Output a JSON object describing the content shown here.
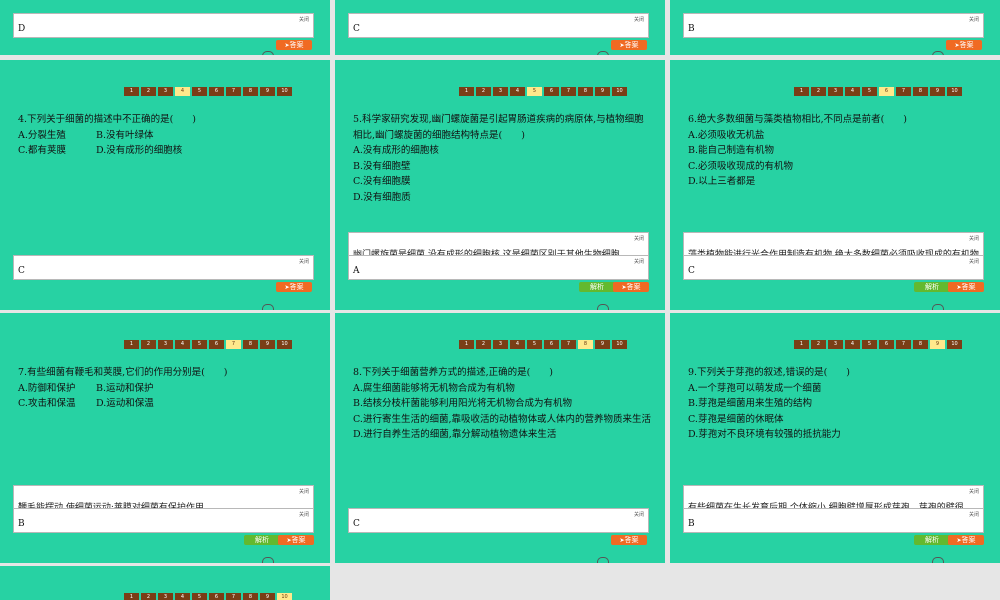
{
  "nav_numbers": [
    "1",
    "2",
    "3",
    "4",
    "5",
    "6",
    "7",
    "8",
    "9",
    "10"
  ],
  "close_label": "关闭",
  "answer_button_label": "答案",
  "analysis_button_label": "解析",
  "top_row": [
    {
      "answer": "D"
    },
    {
      "answer": "C"
    },
    {
      "answer": "B"
    }
  ],
  "questions": [
    {
      "stem": "4.下列关于细菌的描述中不正确的是(　　)",
      "options": [
        "A.分裂生殖",
        "B.没有叶绿体",
        "C.都有荚膜",
        "D.没有成形的细胞核"
      ],
      "answer": "C",
      "current": 4
    },
    {
      "stem": "5.科学家研究发现,幽门螺旋菌是引起胃肠道疾病的病原体,与植物细胞相比,幽门螺旋菌的细胞结构特点是(　　)",
      "options": [
        "A.没有成形的细胞核",
        "B.没有细胞壁",
        "C.没有细胞膜",
        "D.没有细胞质"
      ],
      "answer": "A",
      "current": 5,
      "explanation": "幽门螺旋菌是细菌,没有成形的细胞核,这是细菌区别于其他生物细胞"
    },
    {
      "stem": "6.绝大多数细菌与藻类植物相比,不同点是前者(　　)",
      "options": [
        "A.必须吸收无机盐",
        "B.能自己制造有机物",
        "C.必须吸收现成的有机物",
        "D.以上三者都是"
      ],
      "answer": "C",
      "current": 6,
      "explanation": "藻类植物能进行光合作用制造有机物,绝大多数细菌必须吸收现成的有机物"
    },
    {
      "stem": "7.有些细菌有鞭毛和荚膜,它们的作用分别是(　　)",
      "options": [
        "A.防御和保护",
        "B.运动和保护",
        "C.攻击和保温",
        "D.运动和保温"
      ],
      "answer": "B",
      "current": 7,
      "explanation": "鞭毛能摆动,使细菌运动;荚膜对细菌有保护作用"
    },
    {
      "stem": "8.下列关于细菌营养方式的描述,正确的是(　　)",
      "options": [
        "A.腐生细菌能够将无机物合成为有机物",
        "B.结核分枝杆菌能够利用阳光将无机物合成为有机物",
        "C.进行寄生生活的细菌,靠吸收活的动植物体或人体内的营养物质来生活",
        "D.进行自养生活的细菌,靠分解动植物遗体来生活"
      ],
      "answer": "C",
      "current": 8
    },
    {
      "stem": "9.下列关于芽孢的叙述,错误的是(　　)",
      "options": [
        "A.一个芽孢可以萌发成一个细菌",
        "B.芽孢是细菌用来生殖的结构",
        "C.芽孢是细菌的休眠体",
        "D.芽孢对不良环境有较强的抵抗能力"
      ],
      "answer": "B",
      "current": 9,
      "explanation": "有些细菌在生长发育后期,个体缩小,细胞壁增厚形成芽孢。芽孢的壁很"
    }
  ],
  "bottom_slide": {
    "current": 10
  }
}
